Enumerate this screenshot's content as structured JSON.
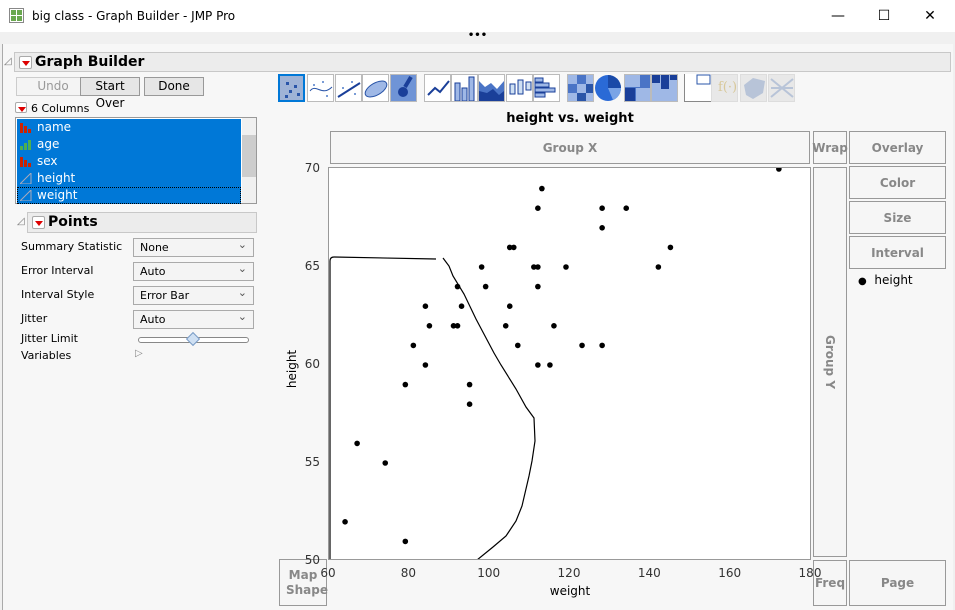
{
  "window": {
    "title": "big class - Graph Builder - JMP Pro",
    "minimize": "—",
    "maximize": "☐",
    "close": "✕",
    "more": "•••"
  },
  "graph_builder": {
    "title": "Graph Builder",
    "buttons": {
      "undo": "Undo",
      "start_over": "Start Over",
      "done": "Done"
    },
    "columns_label": "6 Columns",
    "columns": [
      {
        "name": "name",
        "type": "nominal",
        "icon_color": "#cc2200"
      },
      {
        "name": "age",
        "type": "ordinal",
        "icon_color": "#4caf50"
      },
      {
        "name": "sex",
        "type": "nominal",
        "icon_color": "#cc2200"
      },
      {
        "name": "height",
        "type": "continuous",
        "icon_color": "#6a7fb0"
      },
      {
        "name": "weight",
        "type": "continuous",
        "icon_color": "#6a7fb0"
      }
    ],
    "points_panel": {
      "title": "Points",
      "rows": [
        {
          "label": "Summary Statistic",
          "value": "None"
        },
        {
          "label": "Error Interval",
          "value": "Auto"
        },
        {
          "label": "Interval Style",
          "value": "Error Bar"
        },
        {
          "label": "Jitter",
          "value": "Auto"
        }
      ],
      "jitter_limit_label": "Jitter Limit",
      "jitter_limit_fraction": 0.5,
      "variables_label": "Variables"
    },
    "toolbar_icons": [
      "points",
      "smoother",
      "line-of-fit",
      "ellipse",
      "contour",
      "line",
      "bar",
      "area",
      "box-plot",
      "histogram",
      "heatmap",
      "pie",
      "treemap",
      "mosaic",
      "caption-box",
      "formula",
      "map-shapes",
      "parallel"
    ],
    "zones": {
      "group_x": "Group X",
      "group_y": "Group Y",
      "wrap": "Wrap",
      "overlay": "Overlay",
      "color": "Color",
      "size": "Size",
      "interval": "Interval",
      "map_shape": "Map Shape",
      "freq": "Freq",
      "page": "Page"
    },
    "legend": {
      "items": [
        "height"
      ]
    }
  },
  "chart_data": {
    "type": "scatter",
    "title": "height vs. weight",
    "xlabel": "weight",
    "ylabel": "height",
    "xlim": [
      60,
      180
    ],
    "ylim": [
      50,
      70
    ],
    "xticks": [
      "60",
      "80",
      "100",
      "120",
      "140",
      "160",
      "180"
    ],
    "yticks": [
      "50",
      "55",
      "60",
      "65",
      "70"
    ],
    "grid": false,
    "legend_placement": "right",
    "points": [
      [
        172,
        70
      ],
      [
        113,
        69
      ],
      [
        112,
        68
      ],
      [
        128,
        68
      ],
      [
        134,
        68
      ],
      [
        128,
        67
      ],
      [
        105,
        66
      ],
      [
        106,
        66
      ],
      [
        145,
        66
      ],
      [
        98,
        65
      ],
      [
        111,
        65
      ],
      [
        112,
        65
      ],
      [
        119,
        65
      ],
      [
        142,
        65
      ],
      [
        92,
        64
      ],
      [
        99,
        64
      ],
      [
        112,
        64
      ],
      [
        84,
        63
      ],
      [
        93,
        63
      ],
      [
        105,
        63
      ],
      [
        85,
        62
      ],
      [
        91,
        62
      ],
      [
        92,
        62
      ],
      [
        104,
        62
      ],
      [
        116,
        62
      ],
      [
        81,
        61
      ],
      [
        107,
        61
      ],
      [
        123,
        61
      ],
      [
        128,
        61
      ],
      [
        84,
        60
      ],
      [
        112,
        60
      ],
      [
        115,
        60
      ],
      [
        79,
        59
      ],
      [
        95,
        59
      ],
      [
        95,
        58
      ],
      [
        67,
        56
      ],
      [
        74,
        55
      ],
      [
        64,
        52
      ],
      [
        79,
        51
      ]
    ]
  }
}
